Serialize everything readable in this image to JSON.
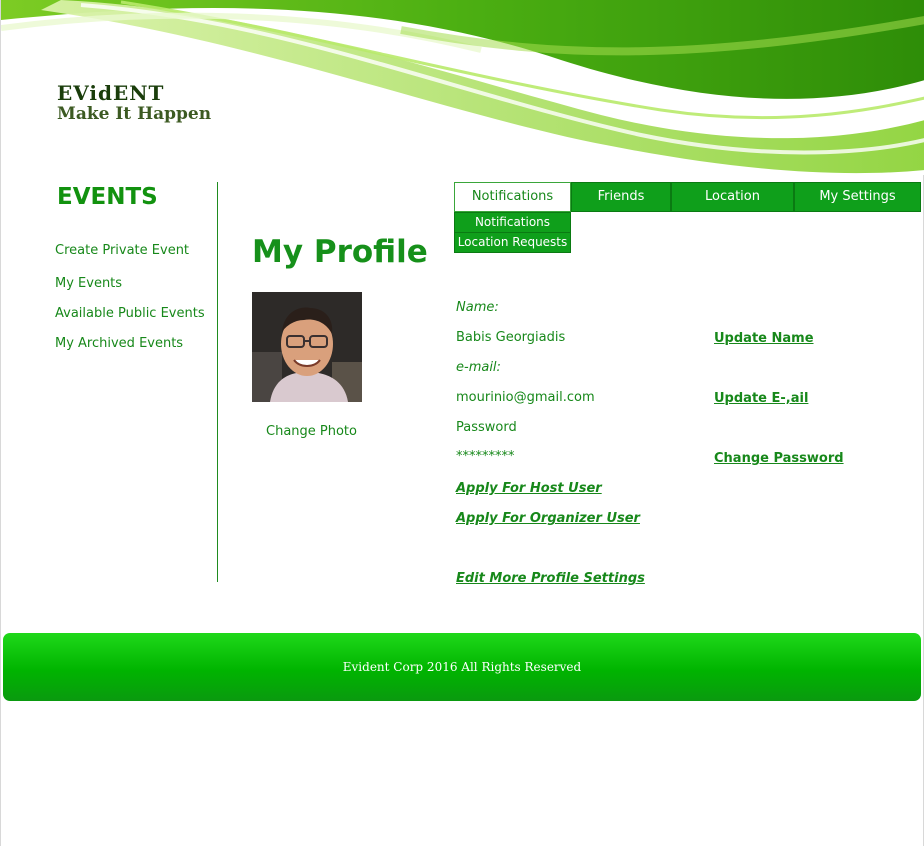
{
  "header": {
    "brand": "EVidENT",
    "tagline": "Make It Happen"
  },
  "sidebar": {
    "title": "EVENTS",
    "items": [
      {
        "label": "Create Private Event"
      },
      {
        "label": "My Events"
      },
      {
        "label": "Available Public Events"
      },
      {
        "label": "My Archived Events"
      }
    ]
  },
  "tabs": [
    {
      "label": "Notifications",
      "active": true
    },
    {
      "label": "Friends"
    },
    {
      "label": "Location"
    },
    {
      "label": "My Settings"
    }
  ],
  "submenu": [
    {
      "label": "Notifications"
    },
    {
      "label": "Location Requests"
    }
  ],
  "profile": {
    "title": "My Profile",
    "change_photo": "Change Photo",
    "name_label": "Name:",
    "name_value": "Babis Georgiadis",
    "email_label": "e-mail:",
    "email_value": "mourinio@gmail.com",
    "password_label": "Password",
    "password_value": "*********",
    "update_name": "Update Name",
    "update_email": "Update E-,ail",
    "change_password": "Change Password",
    "apply_host": "Apply For Host User",
    "apply_organizer": "Apply For Organizer User",
    "edit_more": "Edit More Profile Settings"
  },
  "footer": {
    "text": "Evident Corp  2016 All Rights Reserved"
  },
  "colors": {
    "accent": "#17881a",
    "tab_bg": "#0f9f1b",
    "footer": "#00b400"
  }
}
